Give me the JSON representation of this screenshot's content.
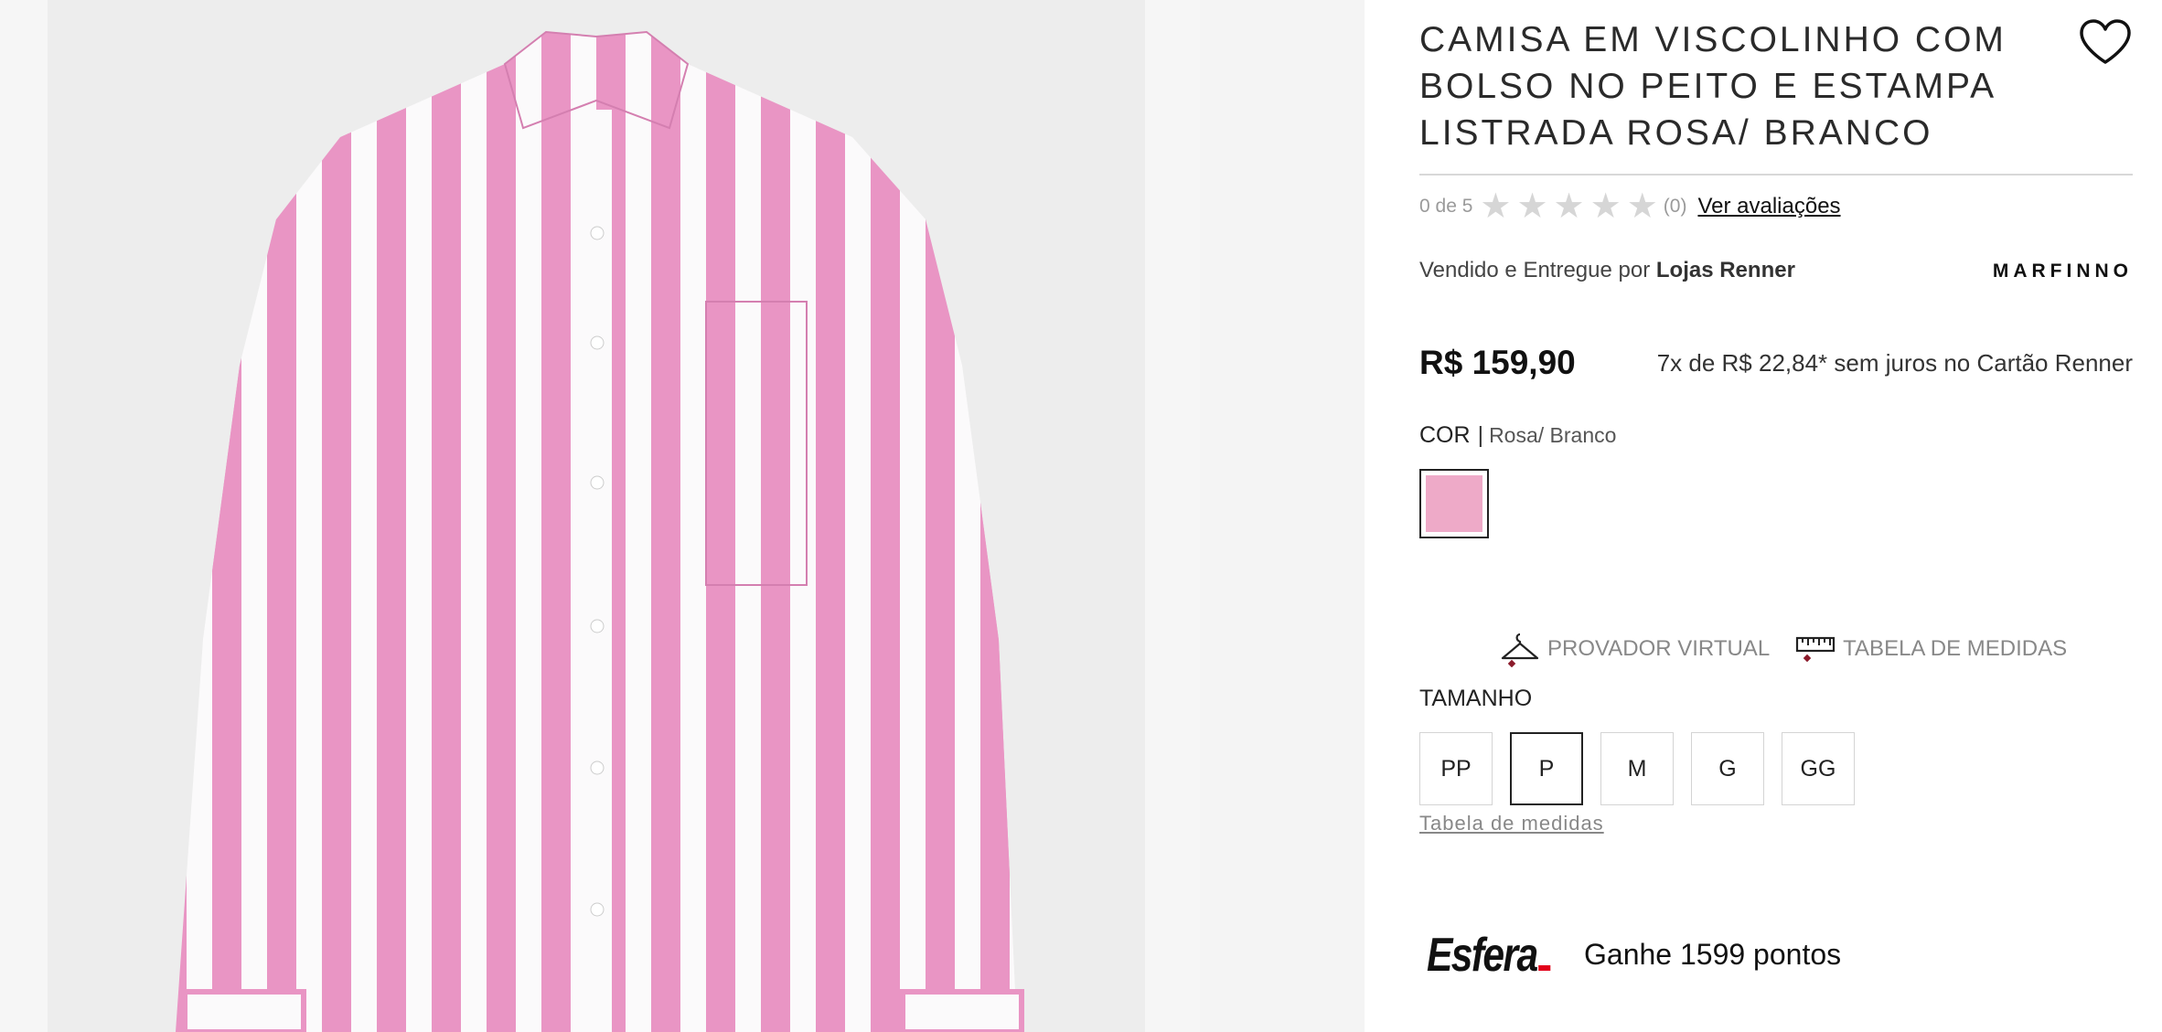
{
  "product": {
    "title": "CAMISA EM VISCOLINHO COM BOLSO NO PEITO E ESTAMPA LISTRADA ROSA/ BRANCO",
    "rating_score": "0 de 5",
    "rating_count": "(0)",
    "reviews_link": "Ver avaliações",
    "seller_prefix": "Vendido e Entregue por",
    "seller_name": "Lojas Renner",
    "brand": "MARFINNO",
    "price": "R$ 159,90",
    "installments": "7x de R$ 22,84* sem juros no Cartão Renner"
  },
  "color": {
    "label": "COR",
    "separator": "|",
    "selected": "Rosa/ Branco",
    "swatch_hex": "#eeaac8"
  },
  "tools": {
    "virtual_fitting": "PROVADOR VIRTUAL",
    "size_chart": "TABELA DE MEDIDAS"
  },
  "size": {
    "label": "TAMANHO",
    "options": [
      "PP",
      "P",
      "M",
      "G",
      "GG"
    ],
    "selected": "P",
    "chart_link": "Tabela de medidas"
  },
  "loyalty": {
    "logo": "Esfera",
    "points_text": "Ganhe 1599 pontos"
  },
  "colors": {
    "stripe_pink": "#e68fbf",
    "accent_red": "#e2001a"
  }
}
